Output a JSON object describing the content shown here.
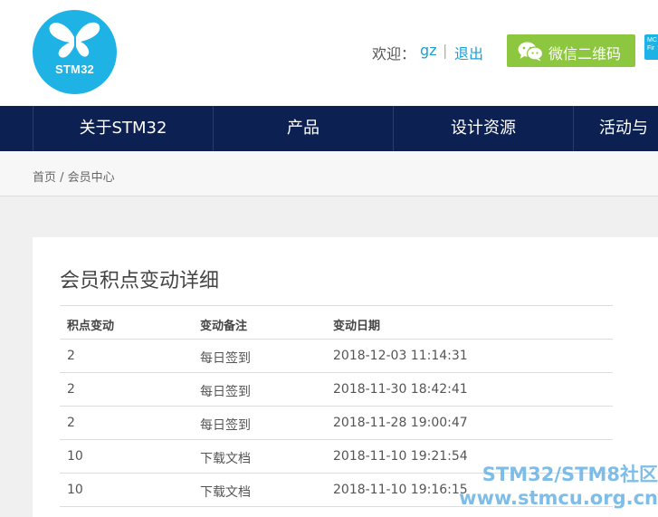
{
  "header": {
    "logo_text": "STM32",
    "welcome_label": "欢迎：",
    "username": "gz",
    "separator": "|",
    "logout_label": "退出",
    "wechat_button_label": "微信二维码",
    "corner_badge_lines": [
      "MC",
      "Fir"
    ]
  },
  "nav": {
    "items": [
      {
        "label": "关于STM32"
      },
      {
        "label": "产品"
      },
      {
        "label": "设计资源"
      },
      {
        "label": "活动与"
      }
    ]
  },
  "breadcrumb": {
    "home": "首页",
    "separator": " / ",
    "current": "会员中心"
  },
  "panel": {
    "title": "会员积点变动详细",
    "columns": [
      "积点变动",
      "变动备注",
      "变动日期"
    ],
    "rows": [
      {
        "points": "2",
        "note": "每日签到",
        "date": "2018-12-03 11:14:31"
      },
      {
        "points": "2",
        "note": "每日签到",
        "date": "2018-11-30 18:42:41"
      },
      {
        "points": "2",
        "note": "每日签到",
        "date": "2018-11-28 19:00:47"
      },
      {
        "points": "10",
        "note": "下载文档",
        "date": "2018-11-10 19:21:54"
      },
      {
        "points": "10",
        "note": "下载文档",
        "date": "2018-11-10 19:16:15"
      }
    ]
  },
  "watermark": {
    "line1": "STM32/STM8社区",
    "line2": "www.stmcu.org.cn"
  },
  "colors": {
    "brand_blue": "#1fb2e5",
    "nav_bg": "#0c2051",
    "wechat_green": "#8dc63f",
    "link": "#1a9fd8"
  },
  "icons": {
    "logo": "butterfly-icon",
    "wechat": "wechat-icon"
  }
}
